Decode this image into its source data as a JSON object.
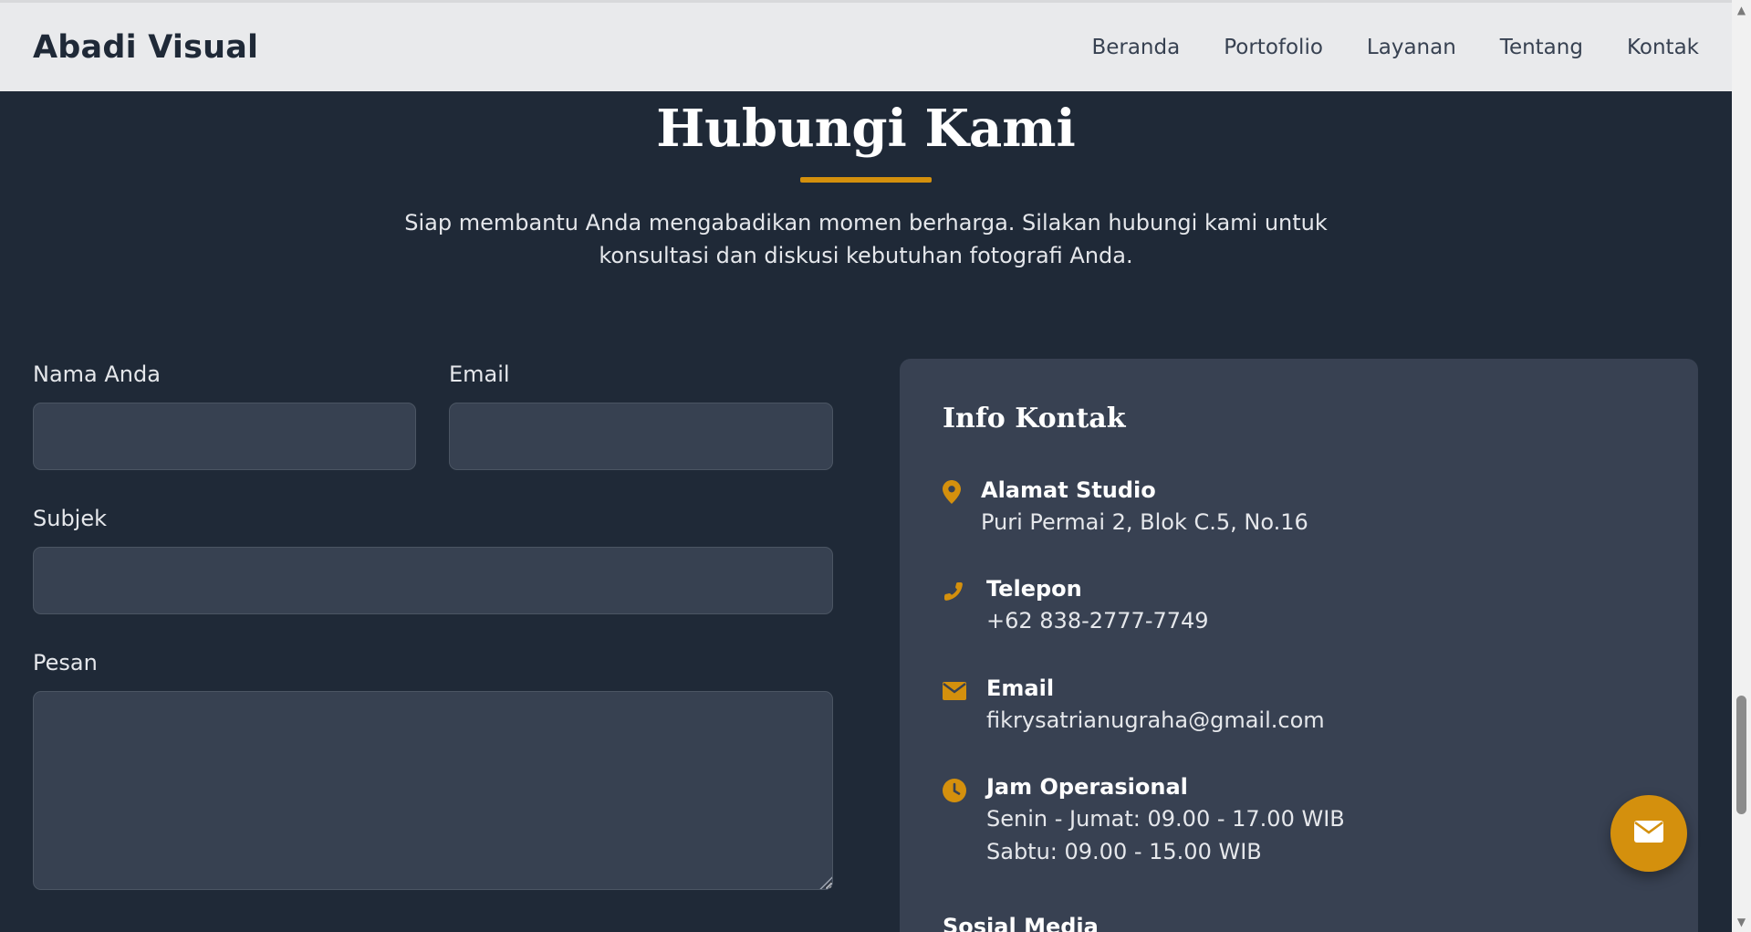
{
  "nav": {
    "brand": "Abadi Visual",
    "links": [
      "Beranda",
      "Portofolio",
      "Layanan",
      "Tentang",
      "Kontak"
    ]
  },
  "section": {
    "title": "Hubungi Kami",
    "description": "Siap membantu Anda mengabadikan momen berharga. Silakan hubungi kami untuk konsultasi dan diskusi kebutuhan fotografi Anda."
  },
  "form": {
    "name_label": "Nama Anda",
    "email_label": "Email",
    "subject_label": "Subjek",
    "message_label": "Pesan",
    "name_value": "",
    "email_value": "",
    "subject_value": "",
    "message_value": ""
  },
  "info": {
    "title": "Info Kontak",
    "address_head": "Alamat Studio",
    "address_value": "Puri Permai 2, Blok C.5, No.16",
    "phone_head": "Telepon",
    "phone_value": "+62 838-2777-7749",
    "email_head": "Email",
    "email_value": "fikrysatrianugraha@gmail.com",
    "hours_head": "Jam Operasional",
    "hours_weekday": "Senin - Jumat: 09.00 - 17.00 WIB",
    "hours_saturday": "Sabtu: 09.00 - 15.00 WIB",
    "social_title": "Sosial Media"
  },
  "icons": {
    "address": "map-pin-icon",
    "phone": "phone-icon",
    "email": "envelope-icon",
    "hours": "clock-icon",
    "fab": "envelope-icon"
  },
  "colors": {
    "background": "#1f2937",
    "card": "#384152",
    "accent": "#d4900d",
    "navbar": "#e9eaec"
  }
}
